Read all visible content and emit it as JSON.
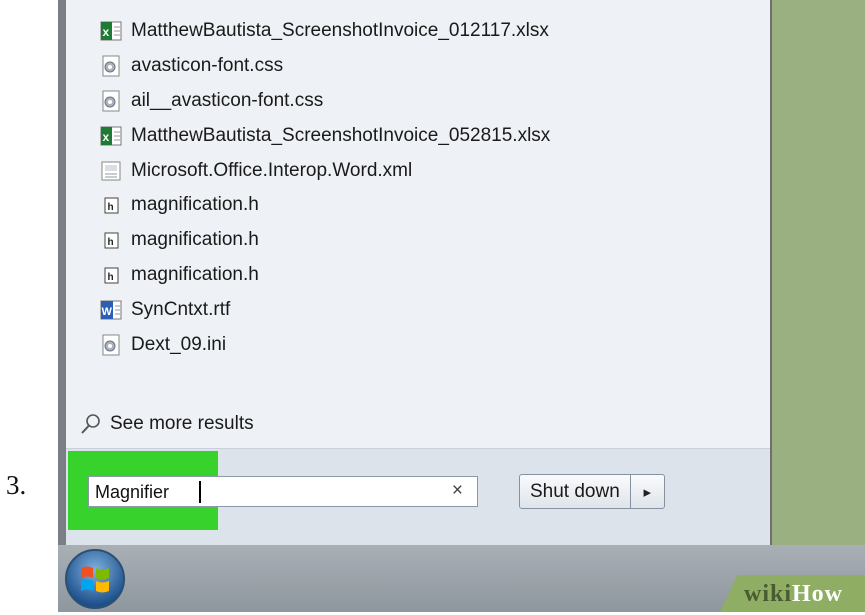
{
  "step_number": "3.",
  "results": [
    {
      "icon": "excel-file-icon",
      "label": "MatthewBautista_ScreenshotInvoice_012117.xlsx"
    },
    {
      "icon": "settings-file-icon",
      "label": "avasticon-font.css"
    },
    {
      "icon": "settings-file-icon",
      "label": "ail__avasticon-font.css"
    },
    {
      "icon": "excel-file-icon",
      "label": "MatthewBautista_ScreenshotInvoice_052815.xlsx"
    },
    {
      "icon": "xml-file-icon",
      "label": "Microsoft.Office.Interop.Word.xml"
    },
    {
      "icon": "header-file-icon",
      "label": "magnification.h"
    },
    {
      "icon": "header-file-icon",
      "label": "magnification.h"
    },
    {
      "icon": "header-file-icon",
      "label": "magnification.h"
    },
    {
      "icon": "word-file-icon",
      "label": "SynCntxt.rtf"
    },
    {
      "icon": "settings-file-icon",
      "label": "Dext_09.ini"
    }
  ],
  "see_more": "See more results",
  "search": {
    "value": "Magnifier",
    "clear": "×"
  },
  "shutdown": {
    "label": "Shut down",
    "arrow": "▸"
  },
  "watermark": {
    "part1": "wiki",
    "part2": "How"
  },
  "colors": {
    "highlight": "#37d22b",
    "desktop": "#9ab080",
    "menu_bg": "#eef1f5"
  }
}
